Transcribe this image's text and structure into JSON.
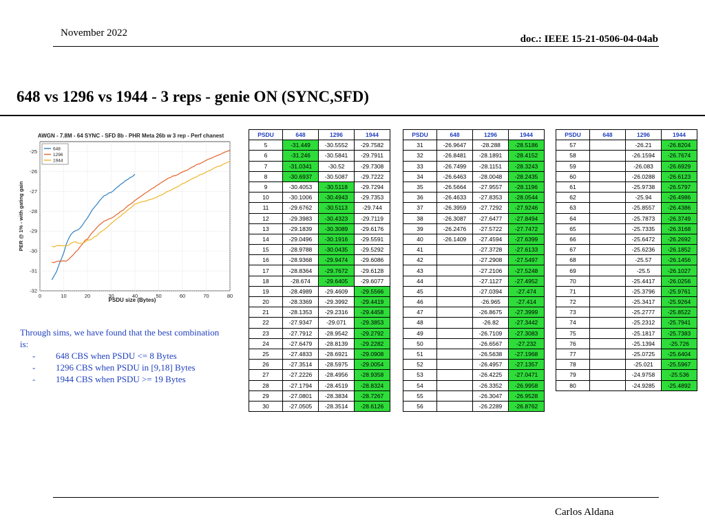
{
  "header": {
    "date": "November 2022",
    "doc": "doc.: IEEE 15-21-0506-04-04ab"
  },
  "title": "648 vs 1296 vs 1944 - 3 reps - genie ON (SYNC,SFD)",
  "footer": {
    "author": "Carlos Aldana"
  },
  "text": {
    "intro": "Through sims, we have found that the best combination is:",
    "bullets": [
      {
        "dash": "-",
        "text": "648 CBS when PSDU <= 8 Bytes"
      },
      {
        "dash": "-",
        "text": "1296 CBS when PSDU in [9,18] Bytes"
      },
      {
        "dash": "-",
        "text": "1944 CBS when PSDU >= 19 Bytes"
      }
    ]
  },
  "colors": {
    "highlight": "#2edc3a",
    "header_text": "#1f3fbf",
    "s648": "#2f7fc1",
    "s1296": "#e2622a",
    "s1944": "#f0b429"
  },
  "tables": [
    {
      "headers": [
        "PSDU",
        "648",
        "1296",
        "1944"
      ],
      "rows": [
        [
          "5",
          "-31.449",
          "-30.5552",
          "-29.7582"
        ],
        [
          "6",
          "-31.246",
          "-30.5841",
          "-29.7911"
        ],
        [
          "7",
          "-31.0341",
          "-30.52",
          "-29.7308"
        ],
        [
          "8",
          "-30.6937",
          "-30.5087",
          "-29.7222"
        ],
        [
          "9",
          "-30.4053",
          "-30.5118",
          "-29.7294"
        ],
        [
          "10",
          "-30.1006",
          "-30.4943",
          "-29.7353"
        ],
        [
          "11",
          "-29.6762",
          "-30.5113",
          "-29.744"
        ],
        [
          "12",
          "-29.3983",
          "-30.4323",
          "-29.7119"
        ],
        [
          "13",
          "-29.1839",
          "-30.3089",
          "-29.6176"
        ],
        [
          "14",
          "-29.0496",
          "-30.1916",
          "-29.5591"
        ],
        [
          "15",
          "-28.9788",
          "-30.0435",
          "-29.5292"
        ],
        [
          "16",
          "-28.9368",
          "-29.9474",
          "-29.6086"
        ],
        [
          "17",
          "-28.8364",
          "-29.7672",
          "-29.6128"
        ],
        [
          "18",
          "-28.674",
          "-29.6405",
          "-29.6077"
        ],
        [
          "19",
          "-28.4989",
          "-29.4609",
          "-29.5566"
        ],
        [
          "20",
          "-28.3369",
          "-29.3992",
          "-29.4419"
        ],
        [
          "21",
          "-28.1353",
          "-29.2316",
          "-29.4458"
        ],
        [
          "22",
          "-27.9347",
          "-29.071",
          "-29.3853"
        ],
        [
          "23",
          "-27.7912",
          "-28.9542",
          "-29.2792"
        ],
        [
          "24",
          "-27.6479",
          "-28.8139",
          "-29.2282"
        ],
        [
          "25",
          "-27.4833",
          "-28.6921",
          "-29.0908"
        ],
        [
          "26",
          "-27.3514",
          "-28.5975",
          "-29.0054"
        ],
        [
          "27",
          "-27.2226",
          "-28.4956",
          "-28.9358"
        ],
        [
          "28",
          "-27.1794",
          "-28.4519",
          "-28.8324"
        ],
        [
          "29",
          "-27.0801",
          "-28.3834",
          "-28.7267"
        ],
        [
          "30",
          "-27.0505",
          "-28.3514",
          "-28.6126"
        ]
      ],
      "highlight": [
        1,
        1,
        1,
        1,
        2,
        2,
        2,
        2,
        2,
        2,
        2,
        2,
        2,
        2,
        3,
        3,
        3,
        3,
        3,
        3,
        3,
        3,
        3,
        3,
        3,
        3
      ]
    },
    {
      "headers": [
        "PSDU",
        "648",
        "1296",
        "1944"
      ],
      "rows": [
        [
          "31",
          "-26.9647",
          "-28.288",
          "-28.5186"
        ],
        [
          "32",
          "-26.8481",
          "-28.1891",
          "-28.4152"
        ],
        [
          "33",
          "-26.7499",
          "-28.1151",
          "-28.3243"
        ],
        [
          "34",
          "-26.6463",
          "-28.0048",
          "-28.2435"
        ],
        [
          "35",
          "-26.5664",
          "-27.9557",
          "-28.1196"
        ],
        [
          "36",
          "-26.4633",
          "-27.8353",
          "-28.0544"
        ],
        [
          "37",
          "-26.3959",
          "-27.7292",
          "-27.9246"
        ],
        [
          "38",
          "-26.3087",
          "-27.6477",
          "-27.8494"
        ],
        [
          "39",
          "-26.2476",
          "-27.5722",
          "-27.7472"
        ],
        [
          "40",
          "-26.1409",
          "-27.4594",
          "-27.6399"
        ],
        [
          "41",
          "",
          "-27.3728",
          "-27.6133"
        ],
        [
          "42",
          "",
          "-27.2908",
          "-27.5497"
        ],
        [
          "43",
          "",
          "-27.2106",
          "-27.5248"
        ],
        [
          "44",
          "",
          "-27.1127",
          "-27.4952"
        ],
        [
          "45",
          "",
          "-27.0394",
          "-27.474"
        ],
        [
          "46",
          "",
          "-26.965",
          "-27.414"
        ],
        [
          "47",
          "",
          "-26.8675",
          "-27.3999"
        ],
        [
          "48",
          "",
          "-26.82",
          "-27.3442"
        ],
        [
          "49",
          "",
          "-26.7109",
          "-27.3083"
        ],
        [
          "50",
          "",
          "-26.6567",
          "-27.232"
        ],
        [
          "51",
          "",
          "-26.5638",
          "-27.1968"
        ],
        [
          "52",
          "",
          "-26.4957",
          "-27.1357"
        ],
        [
          "53",
          "",
          "-26.4225",
          "-27.0471"
        ],
        [
          "54",
          "",
          "-26.3352",
          "-26.9958"
        ],
        [
          "55",
          "",
          "-26.3047",
          "-26.9528"
        ],
        [
          "56",
          "",
          "-26.2289",
          "-26.8762"
        ]
      ],
      "highlight": [
        3,
        3,
        3,
        3,
        3,
        3,
        3,
        3,
        3,
        3,
        3,
        3,
        3,
        3,
        3,
        3,
        3,
        3,
        3,
        3,
        3,
        3,
        3,
        3,
        3,
        3
      ]
    },
    {
      "headers": [
        "PSDU",
        "648",
        "1296",
        "1944"
      ],
      "rows": [
        [
          "57",
          "",
          "-26.21",
          "-26.8204"
        ],
        [
          "58",
          "",
          "-26.1594",
          "-26.7674"
        ],
        [
          "59",
          "",
          "-26.083",
          "-26.6929"
        ],
        [
          "60",
          "",
          "-26.0288",
          "-26.6123"
        ],
        [
          "61",
          "",
          "-25.9738",
          "-26.5797"
        ],
        [
          "62",
          "",
          "-25.94",
          "-26.4986"
        ],
        [
          "63",
          "",
          "-25.8557",
          "-26.4386"
        ],
        [
          "64",
          "",
          "-25.7873",
          "-26.3749"
        ],
        [
          "65",
          "",
          "-25.7335",
          "-26.3168"
        ],
        [
          "66",
          "",
          "-25.6472",
          "-26.2692"
        ],
        [
          "67",
          "",
          "-25.6236",
          "-26.1852"
        ],
        [
          "68",
          "",
          "-25.57",
          "-26.1456"
        ],
        [
          "69",
          "",
          "-25.5",
          "-26.1027"
        ],
        [
          "70",
          "",
          "-25.4417",
          "-26.0256"
        ],
        [
          "71",
          "",
          "-25.3796",
          "-25.9761"
        ],
        [
          "72",
          "",
          "-25.3417",
          "-25.9264"
        ],
        [
          "73",
          "",
          "-25.2777",
          "-25.8522"
        ],
        [
          "74",
          "",
          "-25.2312",
          "-25.7941"
        ],
        [
          "75",
          "",
          "-25.1817",
          "-25.7383"
        ],
        [
          "76",
          "",
          "-25.1394",
          "-25.726"
        ],
        [
          "77",
          "",
          "-25.0725",
          "-25.6404"
        ],
        [
          "78",
          "",
          "-25.021",
          "-25.5967"
        ],
        [
          "79",
          "",
          "-24.9758",
          "-25.536"
        ],
        [
          "80",
          "",
          "-24.9285",
          "-25.4892"
        ]
      ],
      "highlight": [
        3,
        3,
        3,
        3,
        3,
        3,
        3,
        3,
        3,
        3,
        3,
        3,
        3,
        3,
        3,
        3,
        3,
        3,
        3,
        3,
        3,
        3,
        3,
        3
      ]
    }
  ],
  "chart_data": {
    "type": "line",
    "title": "AWGN - 7.8M - 64 SYNC - SFD 8b - PHR Meta 26b w 3 rep - Perf chanest",
    "xlabel": "PSDU size (Bytes)",
    "ylabel": "PER @ 1% - with gating gain",
    "xlim": [
      0,
      80
    ],
    "ylim": [
      -32,
      -24.5
    ],
    "xticks": [
      0,
      10,
      20,
      30,
      40,
      50,
      60,
      70,
      80
    ],
    "yticks": [
      -32,
      -31,
      -30,
      -29,
      -28,
      -27,
      -26,
      -25
    ],
    "grid": true,
    "legend_position": "top-left",
    "series": [
      {
        "name": "648",
        "source_table_col": 1
      },
      {
        "name": "1296",
        "source_table_col": 2
      },
      {
        "name": "1944",
        "source_table_col": 3
      }
    ],
    "x": [
      5,
      6,
      7,
      8,
      9,
      10,
      11,
      12,
      13,
      14,
      15,
      16,
      17,
      18,
      19,
      20,
      21,
      22,
      23,
      24,
      25,
      26,
      27,
      28,
      29,
      30,
      31,
      32,
      33,
      34,
      35,
      36,
      37,
      38,
      39,
      40,
      41,
      42,
      43,
      44,
      45,
      46,
      47,
      48,
      49,
      50,
      51,
      52,
      53,
      54,
      55,
      56,
      57,
      58,
      59,
      60,
      61,
      62,
      63,
      64,
      65,
      66,
      67,
      68,
      69,
      70,
      71,
      72,
      73,
      74,
      75,
      76,
      77,
      78,
      79,
      80
    ],
    "values": {
      "648": [
        -31.449,
        -31.246,
        -31.0341,
        -30.6937,
        -30.4053,
        -30.1006,
        -29.6762,
        -29.3983,
        -29.1839,
        -29.0496,
        -28.9788,
        -28.9368,
        -28.8364,
        -28.674,
        -28.4989,
        -28.3369,
        -28.1353,
        -27.9347,
        -27.7912,
        -27.6479,
        -27.4833,
        -27.3514,
        -27.2226,
        -27.1794,
        -27.0801,
        -27.0505,
        -26.9647,
        -26.8481,
        -26.7499,
        -26.6463,
        -26.5664,
        -26.4633,
        -26.3959,
        -26.3087,
        -26.2476,
        -26.1409
      ],
      "1296": [
        -30.5552,
        -30.5841,
        -30.52,
        -30.5087,
        -30.5118,
        -30.4943,
        -30.5113,
        -30.4323,
        -30.3089,
        -30.1916,
        -30.0435,
        -29.9474,
        -29.7672,
        -29.6405,
        -29.4609,
        -29.3992,
        -29.2316,
        -29.071,
        -28.9542,
        -28.8139,
        -28.6921,
        -28.5975,
        -28.4956,
        -28.4519,
        -28.3834,
        -28.3514,
        -28.288,
        -28.1891,
        -28.1151,
        -28.0048,
        -27.9557,
        -27.8353,
        -27.7292,
        -27.6477,
        -27.5722,
        -27.4594,
        -27.3728,
        -27.2908,
        -27.2106,
        -27.1127,
        -27.0394,
        -26.965,
        -26.8675,
        -26.82,
        -26.7109,
        -26.6567,
        -26.5638,
        -26.4957,
        -26.4225,
        -26.3352,
        -26.3047,
        -26.2289,
        -26.21,
        -26.1594,
        -26.083,
        -26.0288,
        -25.9738,
        -25.94,
        -25.8557,
        -25.7873,
        -25.7335,
        -25.6472,
        -25.6236,
        -25.57,
        -25.5,
        -25.4417,
        -25.3796,
        -25.3417,
        -25.2777,
        -25.2312,
        -25.1817,
        -25.1394,
        -25.0725,
        -25.021,
        -24.9758,
        -24.9285
      ],
      "1944": [
        -29.7582,
        -29.7911,
        -29.7308,
        -29.7222,
        -29.7294,
        -29.7353,
        -29.744,
        -29.7119,
        -29.6176,
        -29.5591,
        -29.5292,
        -29.6086,
        -29.6128,
        -29.6077,
        -29.5566,
        -29.4419,
        -29.4458,
        -29.3853,
        -29.2792,
        -29.2282,
        -29.0908,
        -29.0054,
        -28.9358,
        -28.8324,
        -28.7267,
        -28.6126,
        -28.5186,
        -28.4152,
        -28.3243,
        -28.2435,
        -28.1196,
        -28.0544,
        -27.9246,
        -27.8494,
        -27.7472,
        -27.6399,
        -27.6133,
        -27.5497,
        -27.5248,
        -27.4952,
        -27.474,
        -27.414,
        -27.3999,
        -27.3442,
        -27.3083,
        -27.232,
        -27.1968,
        -27.1357,
        -27.0471,
        -26.9958,
        -26.9528,
        -26.8762,
        -26.8204,
        -26.7674,
        -26.6929,
        -26.6123,
        -26.5797,
        -26.4986,
        -26.4386,
        -26.3749,
        -26.3168,
        -26.2692,
        -26.1852,
        -26.1456,
        -26.1027,
        -26.0256,
        -25.9761,
        -25.9264,
        -25.8522,
        -25.7941,
        -25.7383,
        -25.726,
        -25.6404,
        -25.5967,
        -25.536,
        -25.4892
      ]
    }
  }
}
